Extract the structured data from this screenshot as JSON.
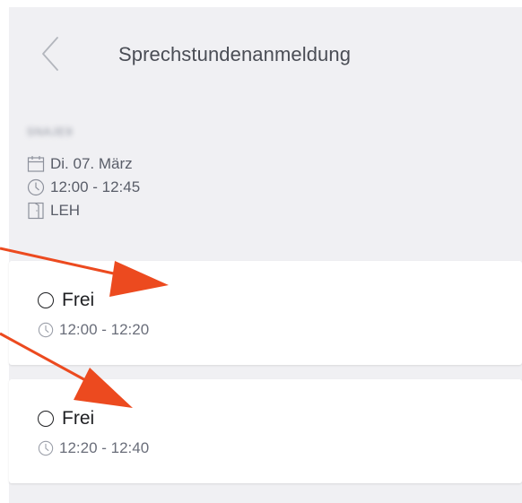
{
  "header": {
    "title": "Sprechstundenanmeldung",
    "back_icon": "chevron-left-icon"
  },
  "appointment": {
    "code": "SNAJE9",
    "date": "Di. 07. März",
    "time": "12:00 - 12:45",
    "room": "LEH"
  },
  "slots": [
    {
      "status": "Frei",
      "time": "12:00 - 12:20"
    },
    {
      "status": "Frei",
      "time": "12:20 - 12:40"
    }
  ],
  "colors": {
    "background": "#f0f0f3",
    "card": "#ffffff",
    "annotation_arrow": "#ec4a1f"
  }
}
